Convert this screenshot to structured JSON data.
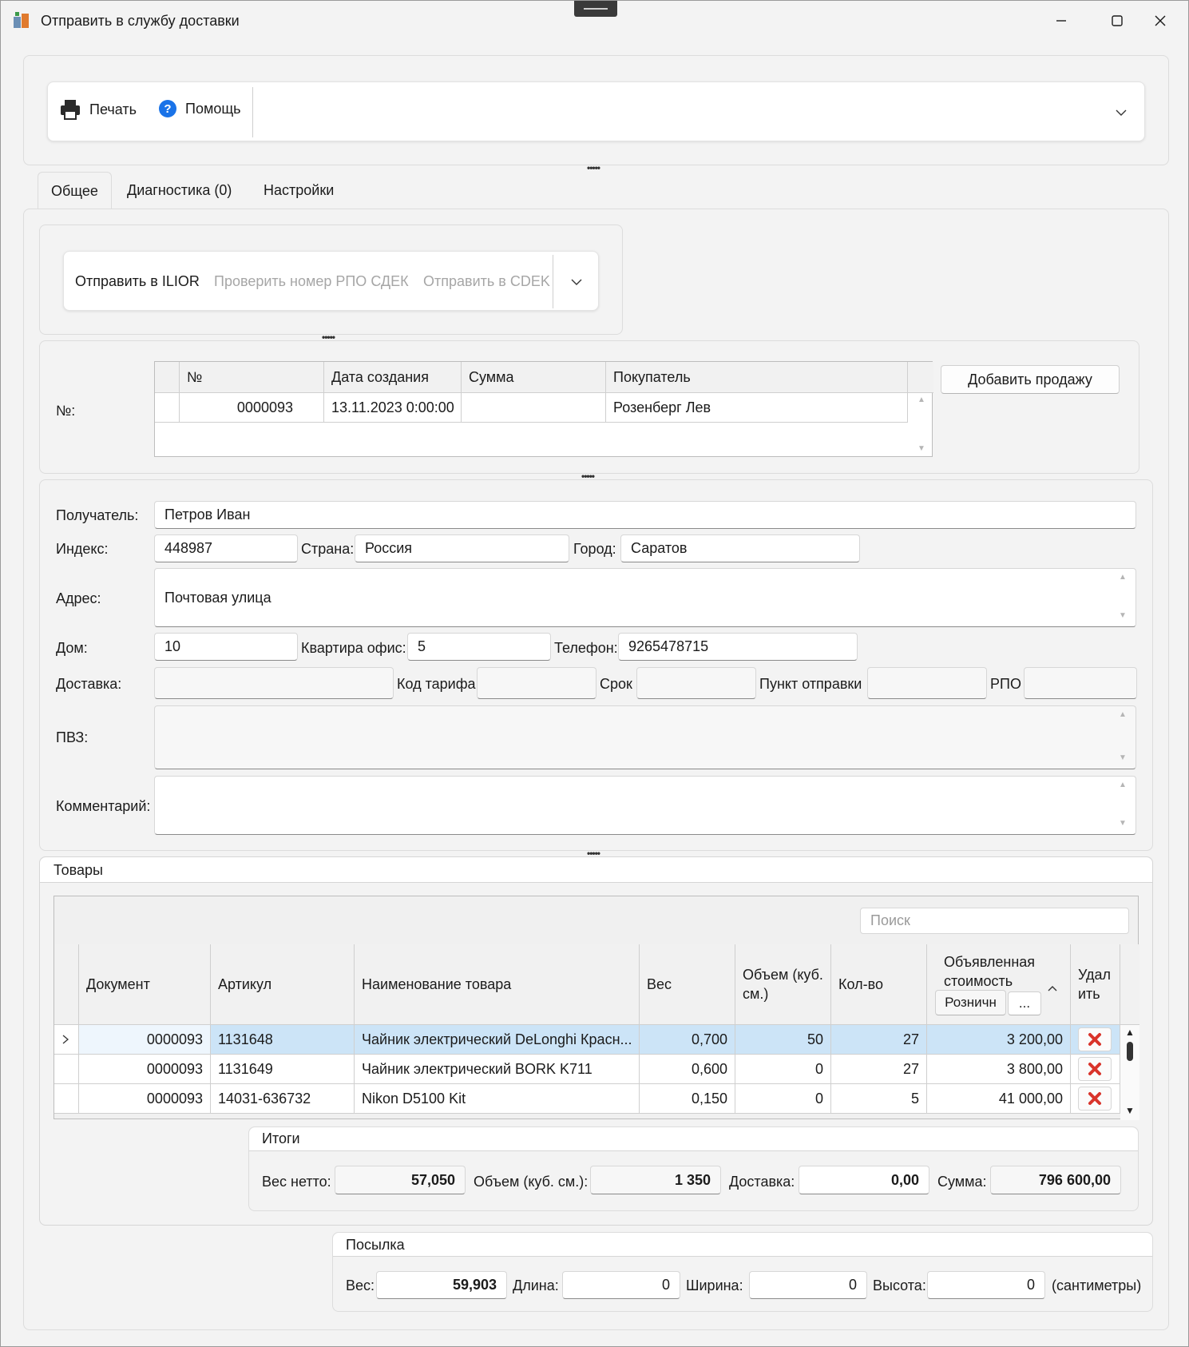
{
  "window": {
    "title": "Отправить в службу доставки"
  },
  "toolbar": {
    "print_label": "Печать",
    "help_label": "Помощь"
  },
  "tabs": [
    {
      "label": "Общее",
      "active": true
    },
    {
      "label": "Диагностика  (0)",
      "active": false
    },
    {
      "label": "Настройки",
      "active": false
    }
  ],
  "actions": {
    "send_ilior": "Отправить в ILIOR",
    "check_rpo": "Проверить номер РПО СДЕК",
    "send_cdek": "Отправить в CDEK"
  },
  "sales": {
    "label": "№:",
    "columns": [
      "№",
      "Дата создания",
      "Сумма",
      "Покупатель"
    ],
    "rows": [
      {
        "number": "0000093",
        "date": "13.11.2023 0:00:00",
        "sum": "",
        "buyer": "Розенберг Лев"
      }
    ],
    "add_button": "Добавить продажу"
  },
  "recipient": {
    "recipient_label": "Получатель:",
    "recipient_value": "Петров Иван",
    "index_label": "Индекс:",
    "index_value": "448987",
    "country_label": "Страна:",
    "country_value": "Россия",
    "city_label": "Город:",
    "city_value": "Саратов",
    "address_label": "Адрес:",
    "address_value": "Почтовая улица",
    "house_label": "Дом:",
    "house_value": "10",
    "apartment_label": "Квартира офис:",
    "apartment_value": "5",
    "phone_label": "Телефон:",
    "phone_value": "9265478715",
    "delivery_label": "Доставка:",
    "delivery_value": "",
    "tariff_label": "Код тарифа",
    "tariff_value": "",
    "term_label": "Срок",
    "term_value": "",
    "point_label": "Пункт отправки",
    "point_value": "",
    "rpo_label": "РПО",
    "rpo_value": "",
    "pvz_label": "ПВЗ:",
    "pvz_value": "",
    "comment_label": "Комментарий:",
    "comment_value": ""
  },
  "goods": {
    "group_title": "Товары",
    "search_placeholder": "Поиск",
    "columns": [
      "Документ",
      "Артикул",
      "Наименование товара",
      "Вес",
      "Объем (куб. см.)",
      "Кол-во",
      "Объявленная стоимость",
      "Удал ить"
    ],
    "price_type_button": "Розничн",
    "price_more_button": "...",
    "rows": [
      {
        "doc": "0000093",
        "article": "1131648",
        "name": "Чайник электрический DeLonghi Красн...",
        "weight": "0,700",
        "volume": "50",
        "qty": "27",
        "cost": "3 200,00",
        "selected": true
      },
      {
        "doc": "0000093",
        "article": "1131649",
        "name": "Чайник электрический BORK K711",
        "weight": "0,600",
        "volume": "0",
        "qty": "27",
        "cost": "3 800,00",
        "selected": false
      },
      {
        "doc": "0000093",
        "article": "14031-636732",
        "name": "Nikon D5100 Kit",
        "weight": "0,150",
        "volume": "0",
        "qty": "5",
        "cost": "41 000,00",
        "selected": false
      }
    ]
  },
  "totals": {
    "group_title": "Итоги",
    "net_weight_label": "Вес нетто:",
    "net_weight_value": "57,050",
    "volume_label": "Объем (куб. см.):",
    "volume_value": "1 350",
    "delivery_label": "Доставка:",
    "delivery_value": "0,00",
    "sum_label": "Сумма:",
    "sum_value": "796 600,00"
  },
  "parcel": {
    "group_title": "Посылка",
    "weight_label": "Вес:",
    "weight_value": "59,903",
    "length_label": "Длина:",
    "length_value": "0",
    "width_label": "Ширина:",
    "width_value": "0",
    "height_label": "Высота:",
    "height_value": "0",
    "units_label": "(сантиметры)"
  },
  "icons": [
    "app-icon",
    "printer-icon",
    "help-icon",
    "minimize-icon",
    "maximize-icon",
    "close-icon",
    "chevron-down-icon",
    "row-pointer-icon",
    "sort-up-icon",
    "delete-icon"
  ],
  "colors": {
    "selected_row": "#cce4f7",
    "help_blue": "#1a73e8",
    "delete_red": "#d9342b"
  }
}
